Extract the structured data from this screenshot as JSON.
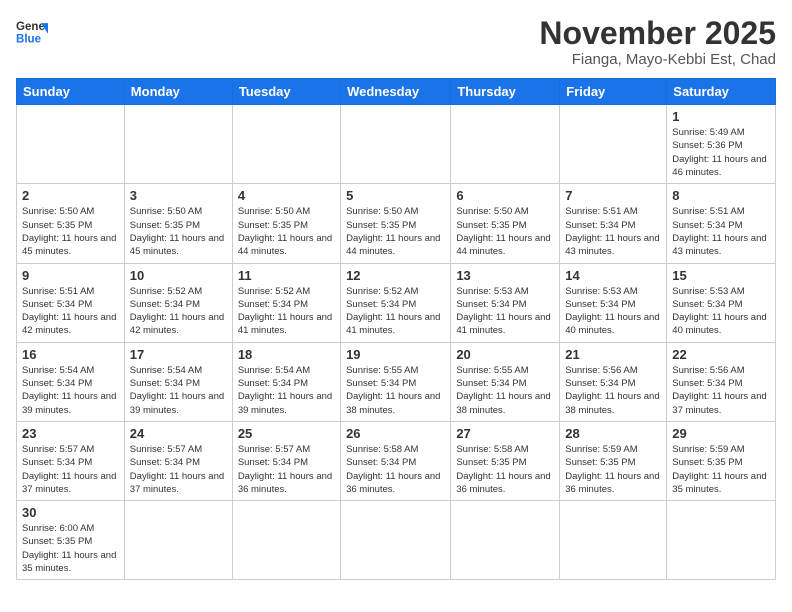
{
  "logo": {
    "line1": "General",
    "line2": "Blue"
  },
  "header": {
    "month": "November 2025",
    "location": "Fianga, Mayo-Kebbi Est, Chad"
  },
  "weekdays": [
    "Sunday",
    "Monday",
    "Tuesday",
    "Wednesday",
    "Thursday",
    "Friday",
    "Saturday"
  ],
  "days": {
    "1": {
      "sunrise": "5:49 AM",
      "sunset": "5:36 PM",
      "daylight": "11 hours and 46 minutes."
    },
    "2": {
      "sunrise": "5:50 AM",
      "sunset": "5:35 PM",
      "daylight": "11 hours and 45 minutes."
    },
    "3": {
      "sunrise": "5:50 AM",
      "sunset": "5:35 PM",
      "daylight": "11 hours and 45 minutes."
    },
    "4": {
      "sunrise": "5:50 AM",
      "sunset": "5:35 PM",
      "daylight": "11 hours and 44 minutes."
    },
    "5": {
      "sunrise": "5:50 AM",
      "sunset": "5:35 PM",
      "daylight": "11 hours and 44 minutes."
    },
    "6": {
      "sunrise": "5:50 AM",
      "sunset": "5:35 PM",
      "daylight": "11 hours and 44 minutes."
    },
    "7": {
      "sunrise": "5:51 AM",
      "sunset": "5:34 PM",
      "daylight": "11 hours and 43 minutes."
    },
    "8": {
      "sunrise": "5:51 AM",
      "sunset": "5:34 PM",
      "daylight": "11 hours and 43 minutes."
    },
    "9": {
      "sunrise": "5:51 AM",
      "sunset": "5:34 PM",
      "daylight": "11 hours and 42 minutes."
    },
    "10": {
      "sunrise": "5:52 AM",
      "sunset": "5:34 PM",
      "daylight": "11 hours and 42 minutes."
    },
    "11": {
      "sunrise": "5:52 AM",
      "sunset": "5:34 PM",
      "daylight": "11 hours and 41 minutes."
    },
    "12": {
      "sunrise": "5:52 AM",
      "sunset": "5:34 PM",
      "daylight": "11 hours and 41 minutes."
    },
    "13": {
      "sunrise": "5:53 AM",
      "sunset": "5:34 PM",
      "daylight": "11 hours and 41 minutes."
    },
    "14": {
      "sunrise": "5:53 AM",
      "sunset": "5:34 PM",
      "daylight": "11 hours and 40 minutes."
    },
    "15": {
      "sunrise": "5:53 AM",
      "sunset": "5:34 PM",
      "daylight": "11 hours and 40 minutes."
    },
    "16": {
      "sunrise": "5:54 AM",
      "sunset": "5:34 PM",
      "daylight": "11 hours and 39 minutes."
    },
    "17": {
      "sunrise": "5:54 AM",
      "sunset": "5:34 PM",
      "daylight": "11 hours and 39 minutes."
    },
    "18": {
      "sunrise": "5:54 AM",
      "sunset": "5:34 PM",
      "daylight": "11 hours and 39 minutes."
    },
    "19": {
      "sunrise": "5:55 AM",
      "sunset": "5:34 PM",
      "daylight": "11 hours and 38 minutes."
    },
    "20": {
      "sunrise": "5:55 AM",
      "sunset": "5:34 PM",
      "daylight": "11 hours and 38 minutes."
    },
    "21": {
      "sunrise": "5:56 AM",
      "sunset": "5:34 PM",
      "daylight": "11 hours and 38 minutes."
    },
    "22": {
      "sunrise": "5:56 AM",
      "sunset": "5:34 PM",
      "daylight": "11 hours and 37 minutes."
    },
    "23": {
      "sunrise": "5:57 AM",
      "sunset": "5:34 PM",
      "daylight": "11 hours and 37 minutes."
    },
    "24": {
      "sunrise": "5:57 AM",
      "sunset": "5:34 PM",
      "daylight": "11 hours and 37 minutes."
    },
    "25": {
      "sunrise": "5:57 AM",
      "sunset": "5:34 PM",
      "daylight": "11 hours and 36 minutes."
    },
    "26": {
      "sunrise": "5:58 AM",
      "sunset": "5:34 PM",
      "daylight": "11 hours and 36 minutes."
    },
    "27": {
      "sunrise": "5:58 AM",
      "sunset": "5:35 PM",
      "daylight": "11 hours and 36 minutes."
    },
    "28": {
      "sunrise": "5:59 AM",
      "sunset": "5:35 PM",
      "daylight": "11 hours and 36 minutes."
    },
    "29": {
      "sunrise": "5:59 AM",
      "sunset": "5:35 PM",
      "daylight": "11 hours and 35 minutes."
    },
    "30": {
      "sunrise": "6:00 AM",
      "sunset": "5:35 PM",
      "daylight": "11 hours and 35 minutes."
    }
  }
}
